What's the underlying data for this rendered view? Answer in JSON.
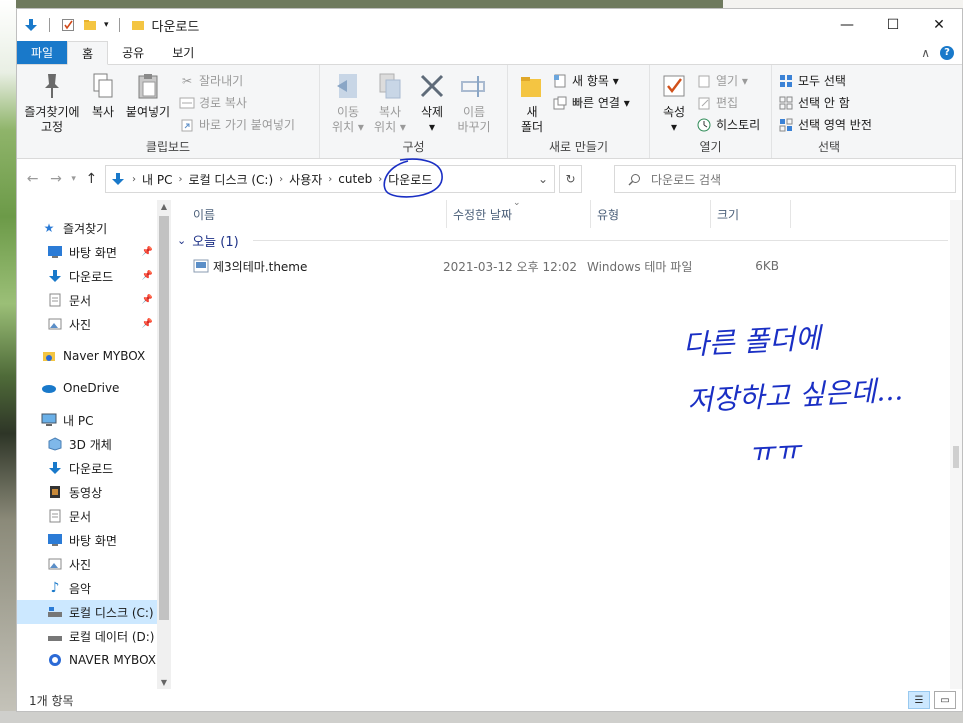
{
  "window": {
    "title": "다운로드",
    "controls": [
      "—",
      "☐",
      "✕"
    ]
  },
  "tabs": {
    "file": "파일",
    "home": "홈",
    "share": "공유",
    "view": "보기"
  },
  "ribbon": {
    "clipboard": {
      "label": "클립보드",
      "pin": "즐겨찾기에\n고정",
      "copy": "복사",
      "paste": "붙여넣기",
      "cut": "잘라내기",
      "copy_path": "경로 복사",
      "paste_shortcut": "바로 가기 붙여넣기"
    },
    "organize": {
      "label": "구성",
      "move_to": "이동\n위치 ▾",
      "copy_to": "복사\n위치 ▾",
      "delete": "삭제\n▾",
      "rename": "이름\n바꾸기"
    },
    "new": {
      "label": "새로 만들기",
      "new_folder": "새\n폴더",
      "new_item": "새 항목 ▾",
      "easy_access": "빠른 연결 ▾"
    },
    "open": {
      "label": "열기",
      "properties": "속성\n▾",
      "open": "열기 ▾",
      "edit": "편집",
      "history": "히스토리"
    },
    "select": {
      "label": "선택",
      "select_all": "모두 선택",
      "select_none": "선택 안 함",
      "invert": "선택 영역 반전"
    }
  },
  "address": {
    "crumbs": [
      "내 PC",
      "로컬 디스크 (C:)",
      "사용자",
      "cuteb",
      "다운로드"
    ],
    "search_placeholder": "다운로드 검색"
  },
  "nav": {
    "quick_access": "즐겨찾기",
    "quick_items": [
      "바탕 화면",
      "다운로드",
      "문서",
      "사진"
    ],
    "mybox": "Naver MYBOX",
    "onedrive": "OneDrive",
    "this_pc": "내 PC",
    "pc_items": [
      "3D 개체",
      "다운로드",
      "동영상",
      "문서",
      "바탕 화면",
      "사진",
      "음악",
      "로컬 디스크 (C:)",
      "로컬 데이터 (D:)",
      "NAVER MYBOX"
    ]
  },
  "columns": {
    "name": "이름",
    "modified": "수정한 날짜",
    "type": "유형",
    "size": "크기"
  },
  "group": {
    "label": "오늘 (1)"
  },
  "files": [
    {
      "name": "제3의테마.theme",
      "modified": "2021-03-12 오후 12:02",
      "type": "Windows 테마 파일",
      "size": "6KB"
    }
  ],
  "status": {
    "count": "1개 항목"
  },
  "annotation": {
    "line1": "다른 폴더에",
    "line2": "저장하고 싶은데...",
    "line3": "ㅠㅠ"
  },
  "colors": {
    "accent": "#1979ca",
    "selection": "#cce8ff",
    "ink": "#1a2fc4"
  }
}
